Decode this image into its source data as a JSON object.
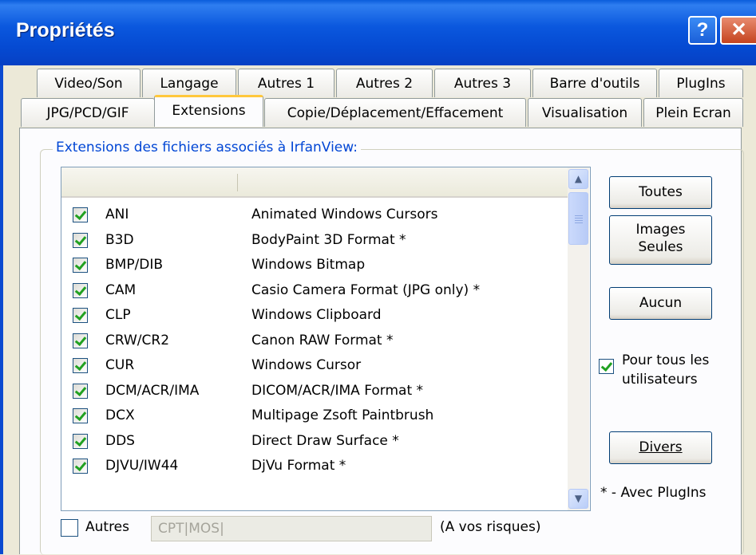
{
  "window": {
    "title": "Propriétés",
    "help_glyph": "?",
    "close_glyph": "✕"
  },
  "tabs": {
    "row1": [
      "Video/Son",
      "Langage",
      "Autres 1",
      "Autres 2",
      "Autres 3",
      "Barre d'outils",
      "PlugIns"
    ],
    "row2": [
      "JPG/PCD/GIF",
      "Extensions",
      "Copie/Déplacement/Effacement",
      "Visualisation",
      "Plein Ecran"
    ],
    "active": "Extensions"
  },
  "group": {
    "legend": "Extensions des fichiers associés à IrfanView:"
  },
  "extensions": [
    {
      "ext": "ANI",
      "desc": "Animated Windows Cursors",
      "checked": true
    },
    {
      "ext": "B3D",
      "desc": "BodyPaint 3D Format *",
      "checked": true
    },
    {
      "ext": "BMP/DIB",
      "desc": "Windows Bitmap",
      "checked": true
    },
    {
      "ext": "CAM",
      "desc": "Casio Camera Format (JPG only) *",
      "checked": true
    },
    {
      "ext": "CLP",
      "desc": "Windows Clipboard",
      "checked": true
    },
    {
      "ext": "CRW/CR2",
      "desc": "Canon RAW Format *",
      "checked": true
    },
    {
      "ext": "CUR",
      "desc": "Windows Cursor",
      "checked": true
    },
    {
      "ext": "DCM/ACR/IMA",
      "desc": "DICOM/ACR/IMA Format *",
      "checked": true
    },
    {
      "ext": "DCX",
      "desc": "Multipage Zsoft Paintbrush",
      "checked": true
    },
    {
      "ext": "DDS",
      "desc": "Direct Draw Surface *",
      "checked": true
    },
    {
      "ext": "DJVU/IW44",
      "desc": "DjVu Format *",
      "checked": true
    }
  ],
  "buttons": {
    "toutes": "Toutes",
    "images_line1": "Images",
    "images_line2": "Seules",
    "aucun": "Aucun",
    "divers": "Divers"
  },
  "all_users": {
    "line1": "Pour tous les",
    "line2": "utilisateurs",
    "checked": true
  },
  "plugins_note": "* - Avec PlugIns",
  "autres": {
    "label": "Autres",
    "value": "CPT|MOS|",
    "risk": "(A vos risques)",
    "checked": false
  },
  "colors": {
    "titlebar": "#0b58de",
    "legend_text": "#0046d5",
    "tab_highlight": "#ffc83c",
    "check": "#21a121"
  }
}
